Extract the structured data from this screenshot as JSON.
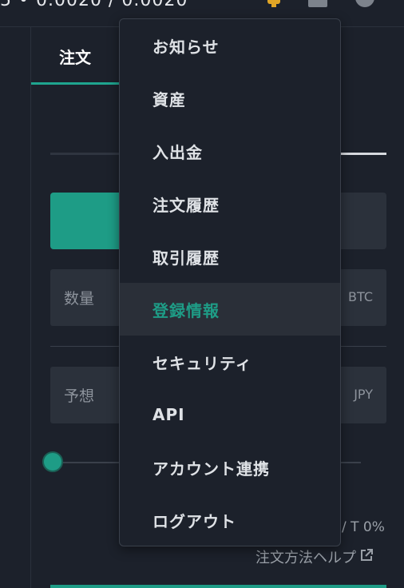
{
  "header": {
    "price_fragment": "5   • 0.0020 / 0.0020"
  },
  "order_panel": {
    "tab_label": "注文",
    "amount_label": "数量",
    "amount_unit": "BTC",
    "price_label": "予想",
    "price_unit": "JPY",
    "fee_text": "/ T 0%",
    "help_link": "注文方法ヘルプ"
  },
  "menu": {
    "items": [
      {
        "label": "お知らせ",
        "active": false
      },
      {
        "label": "資産",
        "active": false
      },
      {
        "label": "入出金",
        "active": false
      },
      {
        "label": "注文履歴",
        "active": false
      },
      {
        "label": "取引履歴",
        "active": false
      },
      {
        "label": "登録情報",
        "active": true
      },
      {
        "label": "セキュリティ",
        "active": false
      },
      {
        "label": "API",
        "active": false
      },
      {
        "label": "アカウント連携",
        "active": false
      },
      {
        "label": "ログアウト",
        "active": false
      }
    ]
  },
  "colors": {
    "accent": "#1e9c86",
    "background": "#1c212b",
    "menu_active_bg": "#2a2f38"
  },
  "icons": [
    "trophy-icon",
    "user-icon",
    "help-icon",
    "external-link-icon"
  ]
}
